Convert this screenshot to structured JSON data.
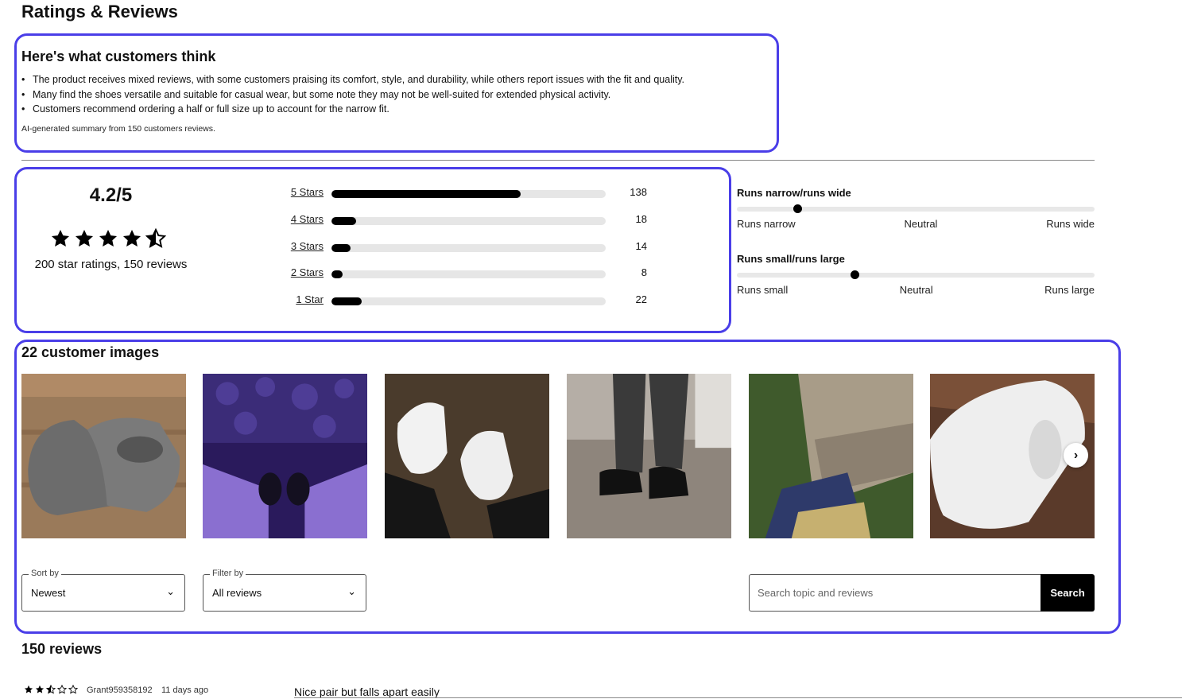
{
  "page": {
    "title": "Ratings & Reviews"
  },
  "summary": {
    "heading": "Here's what customers think",
    "bullets": [
      "The product receives mixed reviews, with some customers praising its comfort, style, and durability, while others report issues with the fit and quality.",
      "Many find the shoes versatile and suitable for casual wear, but some note they may not be well-suited for extended physical activity.",
      "Customers recommend ordering a half or full size up to account for the narrow fit."
    ],
    "note": "AI-generated summary from 150 customers reviews."
  },
  "rating": {
    "average": "4.2/5",
    "stars_value": 4.5,
    "count_text": "200 star ratings, 150 reviews",
    "histogram": [
      {
        "label": "5 Stars",
        "count": 138
      },
      {
        "label": "4 Stars",
        "count": 18
      },
      {
        "label": "3 Stars",
        "count": 14
      },
      {
        "label": "2 Stars",
        "count": 8
      },
      {
        "label": "1 Star",
        "count": 22
      }
    ]
  },
  "fit": [
    {
      "title": "Runs narrow/runs wide",
      "position": 0.17,
      "low": "Runs narrow",
      "mid": "Neutral",
      "high": "Runs wide"
    },
    {
      "title": "Runs small/runs large",
      "position": 0.33,
      "low": "Runs small",
      "mid": "Neutral",
      "high": "Runs large"
    }
  ],
  "images": {
    "title": "22 customer images",
    "thumbnails": [
      "grey-sneakers-photo",
      "purple-lit-shoes-photo",
      "white-sneakers-photo",
      "black-sneakers-photo",
      "outdoor-steps-photo",
      "white-sneaker-closeup-photo"
    ],
    "next_icon": "chevron-right-icon"
  },
  "controls": {
    "sort": {
      "legend": "Sort by",
      "value": "Newest"
    },
    "filter": {
      "legend": "Filter by",
      "value": "All reviews"
    },
    "search": {
      "placeholder": "Search topic and reviews",
      "button": "Search"
    }
  },
  "reviews": {
    "title": "150 reviews",
    "items": [
      {
        "stars_value": 2.5,
        "author": "Grant959358192",
        "date": "11 days ago",
        "title": "Nice pair but falls apart easily"
      }
    ]
  },
  "colors": {
    "highlight": "#4a3ee8",
    "bar_fill": "#000000",
    "bar_track": "#e6e6e6",
    "button_bg": "#000000"
  }
}
